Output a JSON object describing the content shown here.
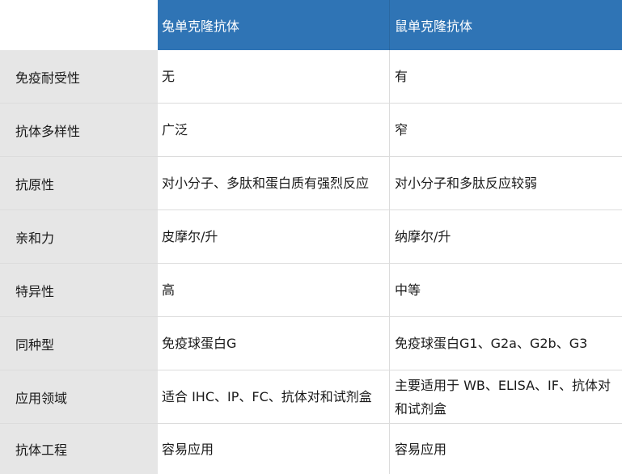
{
  "header": {
    "col1": "兔单克隆抗体",
    "col2": "鼠单克隆抗体"
  },
  "rows": [
    {
      "label": "免疫耐受性",
      "rabbit": "无",
      "mouse": "有"
    },
    {
      "label": "抗体多样性",
      "rabbit": "广泛",
      "mouse": "窄"
    },
    {
      "label": "抗原性",
      "rabbit": "对小分子、多肽和蛋白质有强烈反应",
      "mouse": "对小分子和多肽反应较弱"
    },
    {
      "label": "亲和力",
      "rabbit": "皮摩尔/升",
      "mouse": "纳摩尔/升"
    },
    {
      "label": "特异性",
      "rabbit": "高",
      "mouse": "中等"
    },
    {
      "label": "同种型",
      "rabbit": "免疫球蛋白G",
      "mouse": "免疫球蛋白G1、G2a、G2b、G3"
    },
    {
      "label": "应用领域",
      "rabbit": "适合 IHC、IP、FC、抗体对和试剂盒",
      "mouse": "主要适用于 WB、ELISA、IF、抗体对和试剂盒"
    },
    {
      "label": "抗体工程",
      "rabbit": "容易应用",
      "mouse": "容易应用"
    }
  ]
}
